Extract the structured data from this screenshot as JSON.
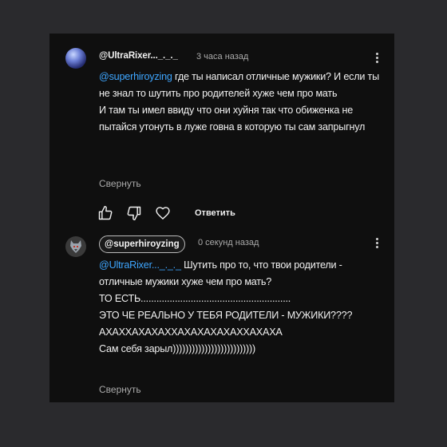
{
  "comments": [
    {
      "author": "@UltraRixer..._._._",
      "time": "3 часа назад",
      "mention": "@superhiroyzing",
      "body": " где ты написал отличные мужики? И если ты не знал то шутить про родителей хуже чем про мать\nИ там ты имел ввиду что они хуйня так что обиженка не пытайся утонуть в луже говна в которую ты сам запрыгнул",
      "collapse_label": "Свернуть",
      "reply_label": "Ответить",
      "icons": [
        "like-icon",
        "dislike-icon",
        "heart-icon",
        "more-vert-icon"
      ]
    },
    {
      "author": "@superhiroyzing",
      "time": "0 секунд назад",
      "mention": "@UltraRixer..._._._",
      "body": " Шутить про то, что твои родители - отличные мужики хуже чем про мать?\nТО ЕСТЬ.........................................................\nЭТО ЧЕ РЕАЛЬНО У ТЕБЯ РОДИТЕЛИ - МУЖИКИ????\nАХАХХАХАХАХХАХАХАХАХАХХАХАХА\nСам себя зарыл))))))))))))))))))))))))))",
      "collapse_label": "Свернуть",
      "icons": [
        "more-vert-icon"
      ]
    }
  ],
  "colors": {
    "background": "#0f0f0f",
    "text": "#f1f1f1",
    "muted": "#aaaaaa",
    "mention": "#3ea6ff"
  }
}
